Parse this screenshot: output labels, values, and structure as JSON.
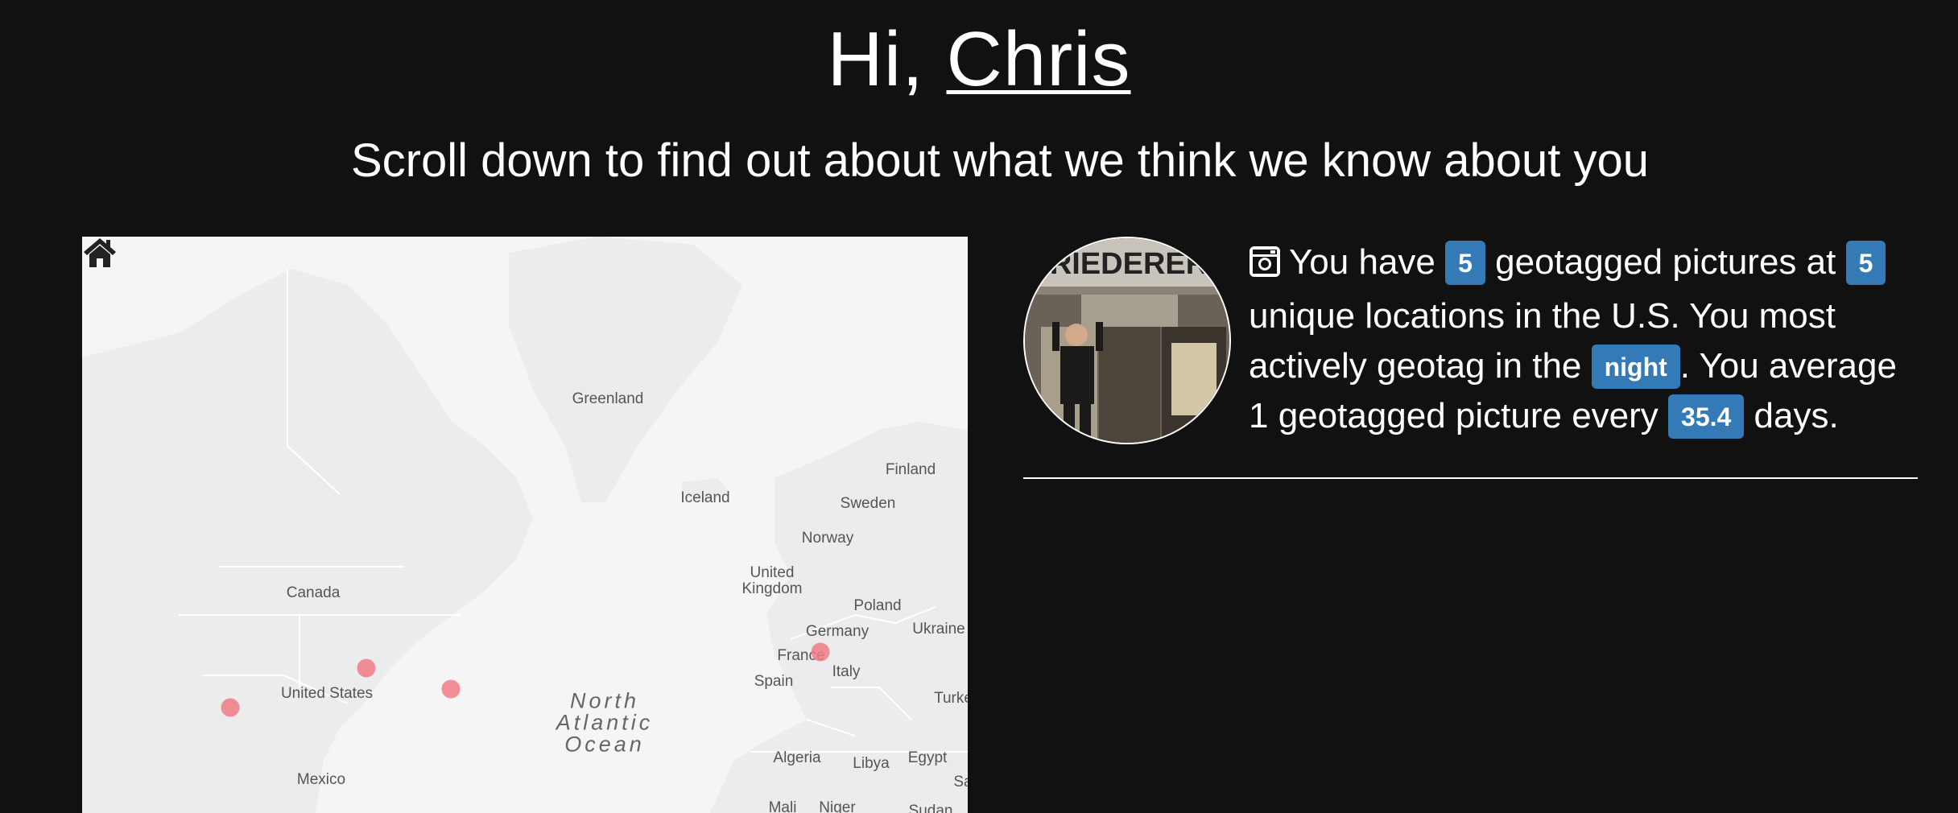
{
  "header": {
    "greeting": "Hi, ",
    "name": "Chris",
    "subtitle": "Scroll down to find out about what we think we know about you"
  },
  "map": {
    "labels": {
      "greenland": "Greenland",
      "iceland": "Iceland",
      "finland": "Finland",
      "sweden": "Sweden",
      "norway": "Norway",
      "united_kingdom": "United\nKingdom",
      "canada": "Canada",
      "poland": "Poland",
      "germany": "Germany",
      "ukraine": "Ukraine",
      "france": "France",
      "italy": "Italy",
      "spain": "Spain",
      "united_states": "United States",
      "ocean": "North\nAtlantic\nOcean",
      "turkey": "Turke",
      "algeria": "Algeria",
      "libya": "Libya",
      "egypt": "Egypt",
      "mexico": "Mexico",
      "mali": "Mali",
      "niger": "Niger",
      "sudan": "Sudan",
      "saudi": "Sa"
    },
    "pin_color": "#f07b85",
    "home_icon": "home-icon"
  },
  "instagram": {
    "icon": "instagram-icon",
    "t1": "You have ",
    "pictures_count": "5",
    "t2": " geotagged pictures at ",
    "locations_count": "5",
    "t3": " unique locations in the U.S. You most actively geotag in the ",
    "time_of_day": "night",
    "t4": ". You average 1 geotagged picture every ",
    "days_avg": "35.4",
    "t5": " days."
  },
  "colors": {
    "background": "#111111",
    "badge": "#337ab7",
    "map_background": "#f3f3f3"
  }
}
